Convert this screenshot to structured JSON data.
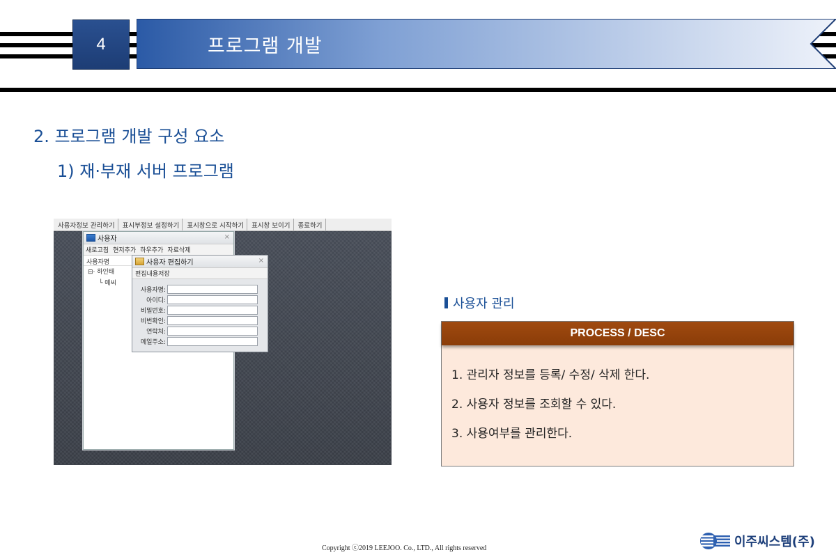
{
  "header": {
    "section_number": "4",
    "title": "프로그램 개발"
  },
  "headings": {
    "h2": "2. 프로그램 개발 구성 요소",
    "h3": "1) 재·부재 서버 프로그램"
  },
  "screenshot": {
    "menubar": [
      "사용자정보 관리하기",
      "표시부정보 설정하기",
      "표시창으로 시작하기",
      "표시창 보이기",
      "종료하기"
    ],
    "user_window": {
      "title": "사용자",
      "toolbar": [
        "새로고침",
        "현저추가",
        "하우추가",
        "자료삭제"
      ],
      "column_header": "사용자명",
      "tree": [
        "하인태",
        "예씨"
      ]
    },
    "edit_window": {
      "title": "사용자 편집하기",
      "toolbar": "편집내용저장",
      "fields": [
        "사용자명:",
        "아이디:",
        "비밀번호:",
        "비번확인:",
        "연락처:",
        "메일주소:"
      ]
    }
  },
  "section_label": "사용자 관리",
  "panel": {
    "header": "PROCESS / DESC",
    "items": [
      "1.  관리자 정보를 등록/ 수정/ 삭제 한다.",
      "2.  사용자 정보를 조회할 수 있다.",
      "3.  사용여부를 관리한다."
    ]
  },
  "footer": {
    "copyright": "Copyright  ⓒ2019 LEEJOO. Co., LTD., All rights reserved",
    "logo_text": "이주씨스템(주)"
  },
  "colors": {
    "accent_blue": "#1a4f96",
    "panel_header": "#94420b",
    "panel_bg": "#fde9dc"
  }
}
